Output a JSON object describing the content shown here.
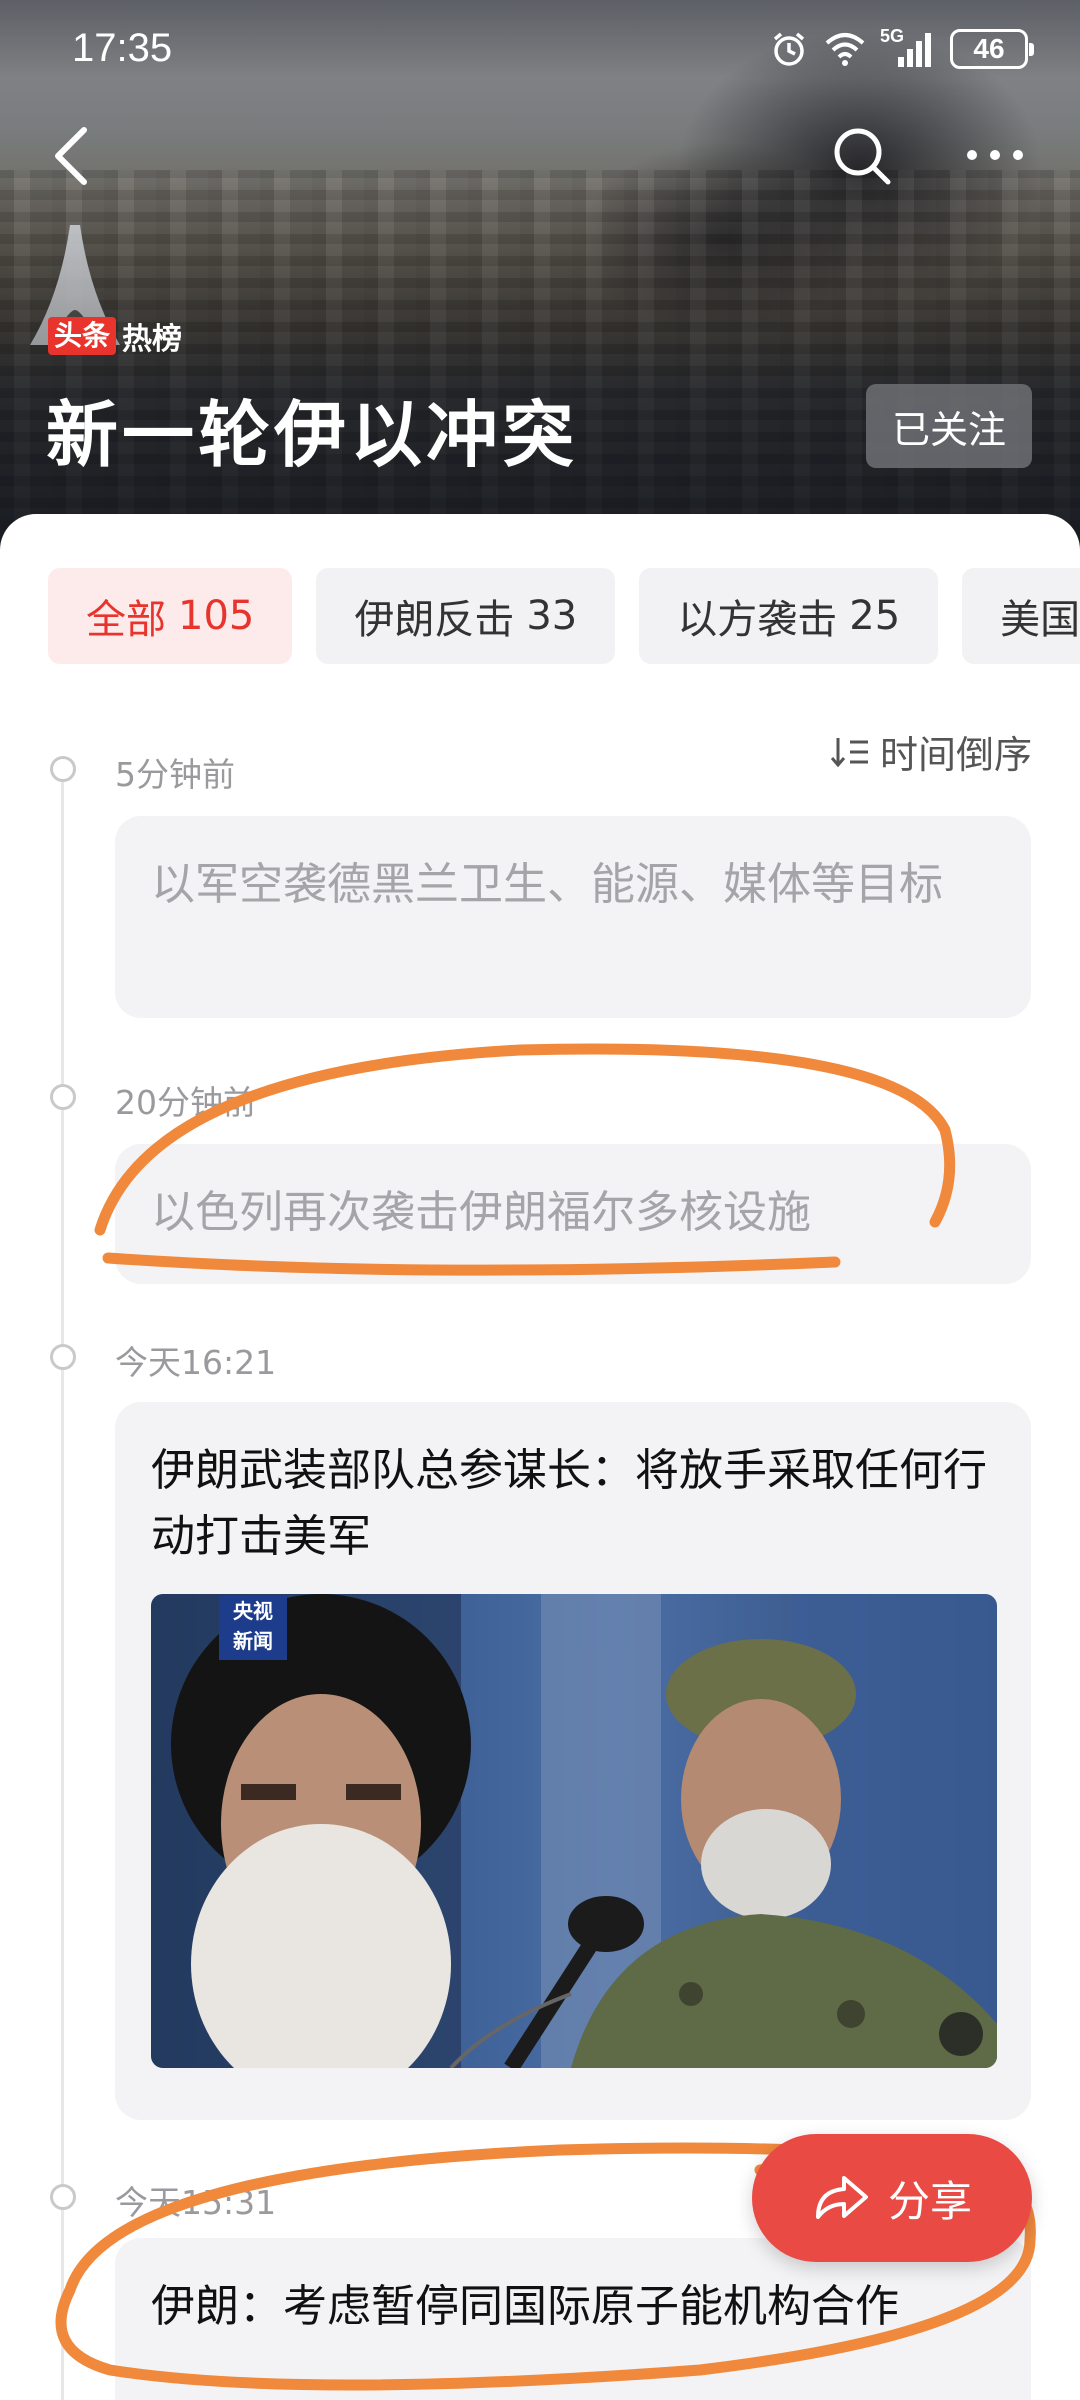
{
  "status_bar": {
    "time": "17:35",
    "network": "5G",
    "battery": "46"
  },
  "header": {
    "brand_left": "头条",
    "brand_right": "热榜",
    "title": "新一轮伊以冲突",
    "follow_label": "已关注"
  },
  "tabs": [
    {
      "label": "全部",
      "count": "105"
    },
    {
      "label": "伊朗反击",
      "count": "33"
    },
    {
      "label": "以方袭击",
      "count": "25"
    },
    {
      "label": "美国",
      "count": ""
    }
  ],
  "sort_label": "时间倒序",
  "timeline": [
    {
      "time": "5分钟前",
      "text": "以军空袭德黑兰卫生、能源、媒体等目标"
    },
    {
      "time": "20分钟前",
      "text": "以色列再次袭击伊朗福尔多核设施"
    },
    {
      "time": "今天16:21",
      "text": "伊朗武装部队总参谋长：将放手采取任何行动打击美军",
      "image_badge": [
        "央视",
        "新闻"
      ]
    },
    {
      "time": "今天15:31",
      "text": "伊朗：考虑暂停同国际原子能机构合作"
    }
  ],
  "share_label": "分享",
  "colors": {
    "accent": "#e8342c",
    "annotation": "#f0893c"
  }
}
